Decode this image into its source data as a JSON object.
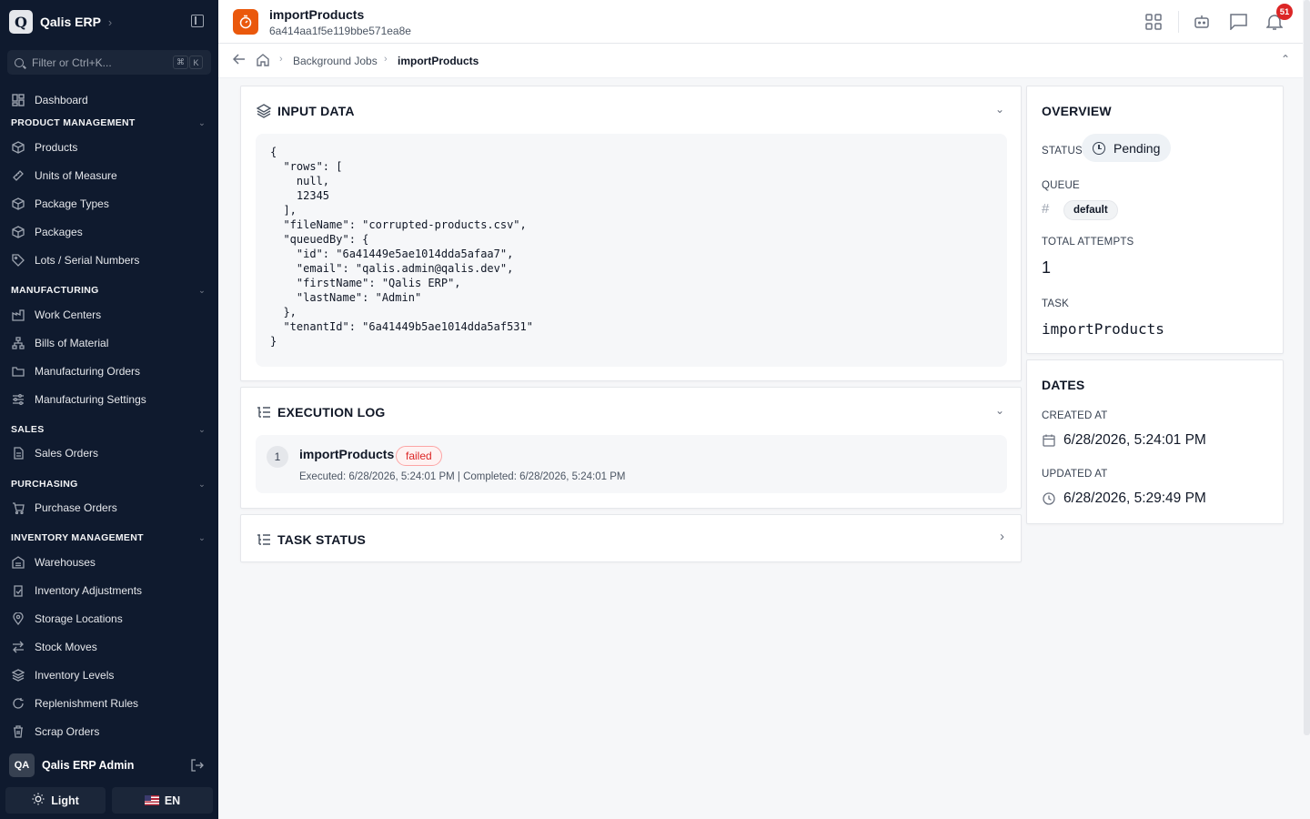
{
  "sidebar": {
    "brand": "Qalis ERP",
    "brand_logo": "Q",
    "filter_placeholder": "Filter or Ctrl+K...",
    "kbd1": "⌘",
    "kbd2": "K",
    "dashboard": "Dashboard",
    "sections": {
      "product": "PRODUCT MANAGEMENT",
      "manufacturing": "MANUFACTURING",
      "sales": "SALES",
      "purchasing": "PURCHASING",
      "inventory": "INVENTORY MANAGEMENT"
    },
    "items": {
      "products": "Products",
      "units": "Units of Measure",
      "package_types": "Package Types",
      "packages": "Packages",
      "lots": "Lots / Serial Numbers",
      "work_centers": "Work Centers",
      "boms": "Bills of Material",
      "mfg_orders": "Manufacturing Orders",
      "mfg_settings": "Manufacturing Settings",
      "sales_orders": "Sales Orders",
      "purchase_orders": "Purchase Orders",
      "warehouses": "Warehouses",
      "inv_adjustments": "Inventory Adjustments",
      "storage_locations": "Storage Locations",
      "stock_moves": "Stock Moves",
      "inv_levels": "Inventory Levels",
      "replenishment": "Replenishment Rules",
      "scrap_orders": "Scrap Orders"
    },
    "user": {
      "initials": "QA",
      "name": "Qalis ERP Admin"
    },
    "theme_label": "Light",
    "lang_label": "EN"
  },
  "header": {
    "title": "importProducts",
    "job_id": "6a414aa1f5e119bbe571ea8e",
    "notification_count": "51"
  },
  "breadcrumb": {
    "parent": "Background Jobs",
    "current": "importProducts"
  },
  "input_data": {
    "title": "INPUT DATA",
    "json": "{\n  \"rows\": [\n    null,\n    12345\n  ],\n  \"fileName\": \"corrupted-products.csv\",\n  \"queuedBy\": {\n    \"id\": \"6a41449e5ae1014dda5afaa7\",\n    \"email\": \"qalis.admin@qalis.dev\",\n    \"firstName\": \"Qalis ERP\",\n    \"lastName\": \"Admin\"\n  },\n  \"tenantId\": \"6a41449b5ae1014dda5af531\"\n}"
  },
  "execution_log": {
    "title": "EXECUTION LOG",
    "entries": [
      {
        "index": "1",
        "name": "importProducts",
        "status": "failed",
        "meta": "Executed: 6/28/2026, 5:24:01 PM | Completed: 6/28/2026, 5:24:01 PM"
      }
    ]
  },
  "task_status": {
    "title": "TASK STATUS"
  },
  "overview": {
    "title": "OVERVIEW",
    "status_label": "STATUS",
    "status_value": "Pending",
    "queue_label": "QUEUE",
    "queue_value": "default",
    "attempts_label": "TOTAL ATTEMPTS",
    "attempts_value": "1",
    "task_label": "TASK",
    "task_value": "importProducts"
  },
  "dates": {
    "title": "DATES",
    "created_label": "CREATED AT",
    "created_value": "6/28/2026, 5:24:01 PM",
    "updated_label": "UPDATED AT",
    "updated_value": "6/28/2026, 5:29:49 PM"
  },
  "colors": {
    "sidebar_bg": "#0f1a2e",
    "accent_orange": "#ea580c",
    "badge_red": "#dc2626"
  }
}
